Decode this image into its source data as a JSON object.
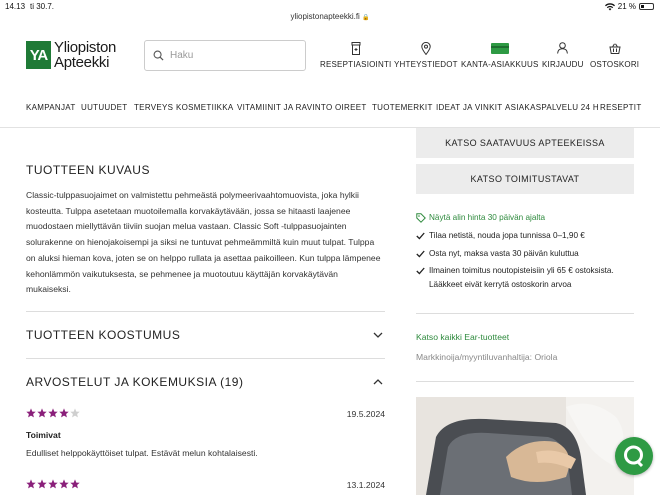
{
  "statusbar": {
    "time": "14.13",
    "date": "ti 30.7.",
    "url": "yliopistonapteekki.fi",
    "battery": "21 %"
  },
  "header": {
    "logo_mark": "YA",
    "logo_line1": "Yliopiston",
    "logo_line2": "Apteekki",
    "search_placeholder": "Haku",
    "nav": [
      {
        "label": "RESEPTIASIOINTI",
        "icon": "prescription-bottle-icon"
      },
      {
        "label": "YHTEYSTIEDOT",
        "icon": "location-pin-icon"
      },
      {
        "label": "KANTA-ASIAKKUUS",
        "icon": "loyalty-card-icon"
      },
      {
        "label": "KIRJAUDU",
        "icon": "user-icon"
      },
      {
        "label": "OSTOSKORI",
        "icon": "basket-icon"
      }
    ]
  },
  "categories": [
    "KAMPANJAT",
    "UUTUUDET",
    "TERVEYS",
    "KOSMETIIKKA",
    "VITAMIINIT JA RAVINTO",
    "OIREET",
    "TUOTEMERKIT",
    "IDEAT JA VINKIT",
    "ASIAKASPALVELU 24 H",
    "RESEPTIT"
  ],
  "description": {
    "title": "TUOTTEEN KUVAUS",
    "text": "Classic-tulppasuojaimet on valmistettu pehmeästä polymeerivaahtomuovista, joka hylkii kosteutta. Tulppa asetetaan muotoilemalla korvakäytävään, jossa se hitaasti laajenee muodostaen miellyttävän tiiviin suojan melua vastaan. Classic Soft -tulppasuojainten solurakenne on hienojakoisempi ja siksi ne tuntuvat pehmeämmiltä kuin muut tulpat. Tulppa on aluksi hieman kova, joten se on helppo rullata ja asettaa paikoilleen. Kun tulppa lämpenee kehonlämmön vaikutuksesta, se pehmenee ja muotoutuu käyttäjän korvakäytävän mukaiseksi."
  },
  "accordion": {
    "composition_title": "TUOTTEEN KOOSTUMUS",
    "reviews_title": "ARVOSTELUT JA KOKEMUKSIA (19)"
  },
  "reviews": [
    {
      "rating": 4,
      "max": 5,
      "date": "19.5.2024",
      "title": "Toimivat",
      "text": "Edulliset helppokäyttöiset tulpat. Estävät melun kohtalaisesti."
    },
    {
      "rating": 5,
      "max": 5,
      "date": "13.1.2024",
      "title": "",
      "text": ""
    }
  ],
  "sidebar": {
    "availability_button": "KATSO SAATAVUUS APTEEKEISSA",
    "delivery_button": "KATSO TOIMITUSTAVAT",
    "lowest_price": "Näytä alin hinta 30 päivän ajalta",
    "benefits": [
      "Tilaa netistä, nouda jopa tunnissa 0–1,90 €",
      "Osta nyt, maksa vasta 30 päivän kuluttua",
      "Ilmainen toimitus noutopisteisiin yli 65 € ostoksista. Lääkkeet eivät kerrytä ostoskorin arvoa"
    ],
    "all_products_link": "Katso kaikki Ear-tuotteet",
    "manufacturer": "Markkinoija/myyntiluvanhaltija: Oriola"
  },
  "colors": {
    "brand_green": "#1f7a36",
    "link_green": "#2e8a3d",
    "star_purple": "#8a1f7a",
    "button_gray": "#ececec"
  }
}
